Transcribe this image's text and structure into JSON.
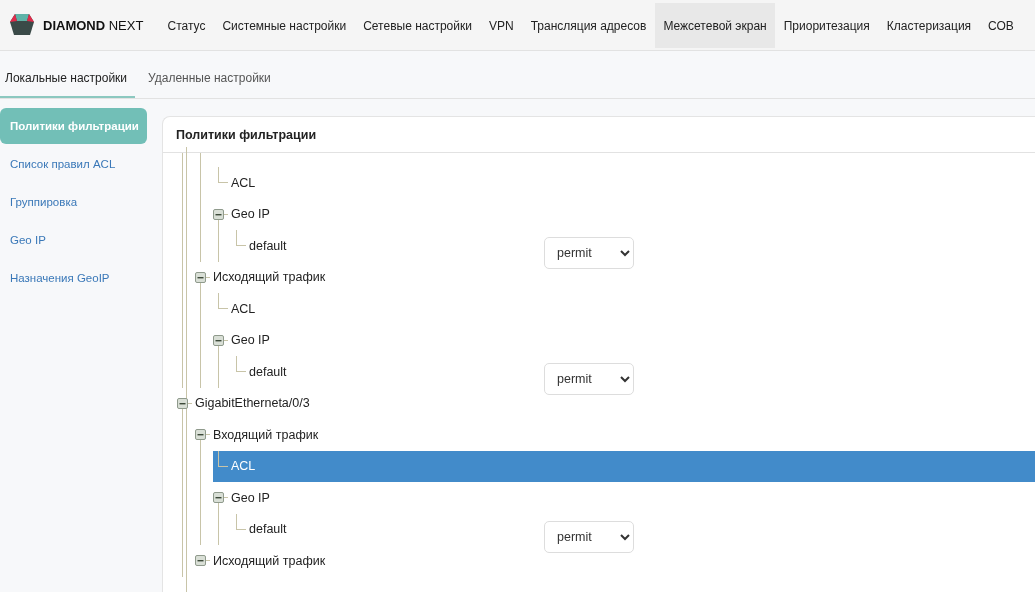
{
  "brand": {
    "name_bold": "DIAMOND",
    "name_light": "NEXT"
  },
  "nav": [
    {
      "label": "Статус",
      "selected": false
    },
    {
      "label": "Системные настройки",
      "selected": false
    },
    {
      "label": "Сетевые настройки",
      "selected": false
    },
    {
      "label": "VPN",
      "selected": false
    },
    {
      "label": "Трансляция адресов",
      "selected": false
    },
    {
      "label": "Межсетевой экран",
      "selected": true
    },
    {
      "label": "Приоритезация",
      "selected": false
    },
    {
      "label": "Кластеризация",
      "selected": false
    },
    {
      "label": "СОВ",
      "selected": false
    }
  ],
  "subtabs": [
    {
      "label": "Локальные настройки",
      "selected": true
    },
    {
      "label": "Удаленные настройки",
      "selected": false
    }
  ],
  "sidebar": {
    "items": [
      {
        "label": "Политики фильтрации",
        "selected": true
      },
      {
        "label": "Список правил ACL",
        "selected": false
      },
      {
        "label": "Группировка",
        "selected": false
      },
      {
        "label": "Geo IP",
        "selected": false
      },
      {
        "label": "Назначения GeoIP",
        "selected": false
      }
    ]
  },
  "panel": {
    "title": "Политики фильтрации",
    "tree": [
      {
        "children": [
          {
            "children": [
              {
                "label": "ACL",
                "selected": false
              },
              {
                "label": "Geo IP",
                "selected": false,
                "expanded": true,
                "children": [
                  {
                    "label": "default",
                    "selected": false,
                    "action": "permit"
                  }
                ]
              }
            ]
          },
          {
            "label": "Исходящий трафик",
            "selected": false,
            "expanded": true,
            "children": [
              {
                "label": "ACL",
                "selected": false
              },
              {
                "label": "Geo IP",
                "selected": false,
                "expanded": true,
                "children": [
                  {
                    "label": "default",
                    "selected": false,
                    "action": "permit"
                  }
                ]
              }
            ]
          }
        ]
      },
      {
        "label": "GigabitEtherneta/0/3",
        "selected": false,
        "expanded": true,
        "children": [
          {
            "label": "Входящий трафик",
            "selected": false,
            "expanded": true,
            "children": [
              {
                "label": "ACL",
                "selected": true
              },
              {
                "label": "Geo IP",
                "selected": false,
                "expanded": true,
                "children": [
                  {
                    "label": "default",
                    "selected": false,
                    "action": "permit"
                  }
                ]
              }
            ]
          },
          {
            "label": "Исходящий трафик",
            "selected": false,
            "expanded": true
          }
        ]
      }
    ]
  }
}
